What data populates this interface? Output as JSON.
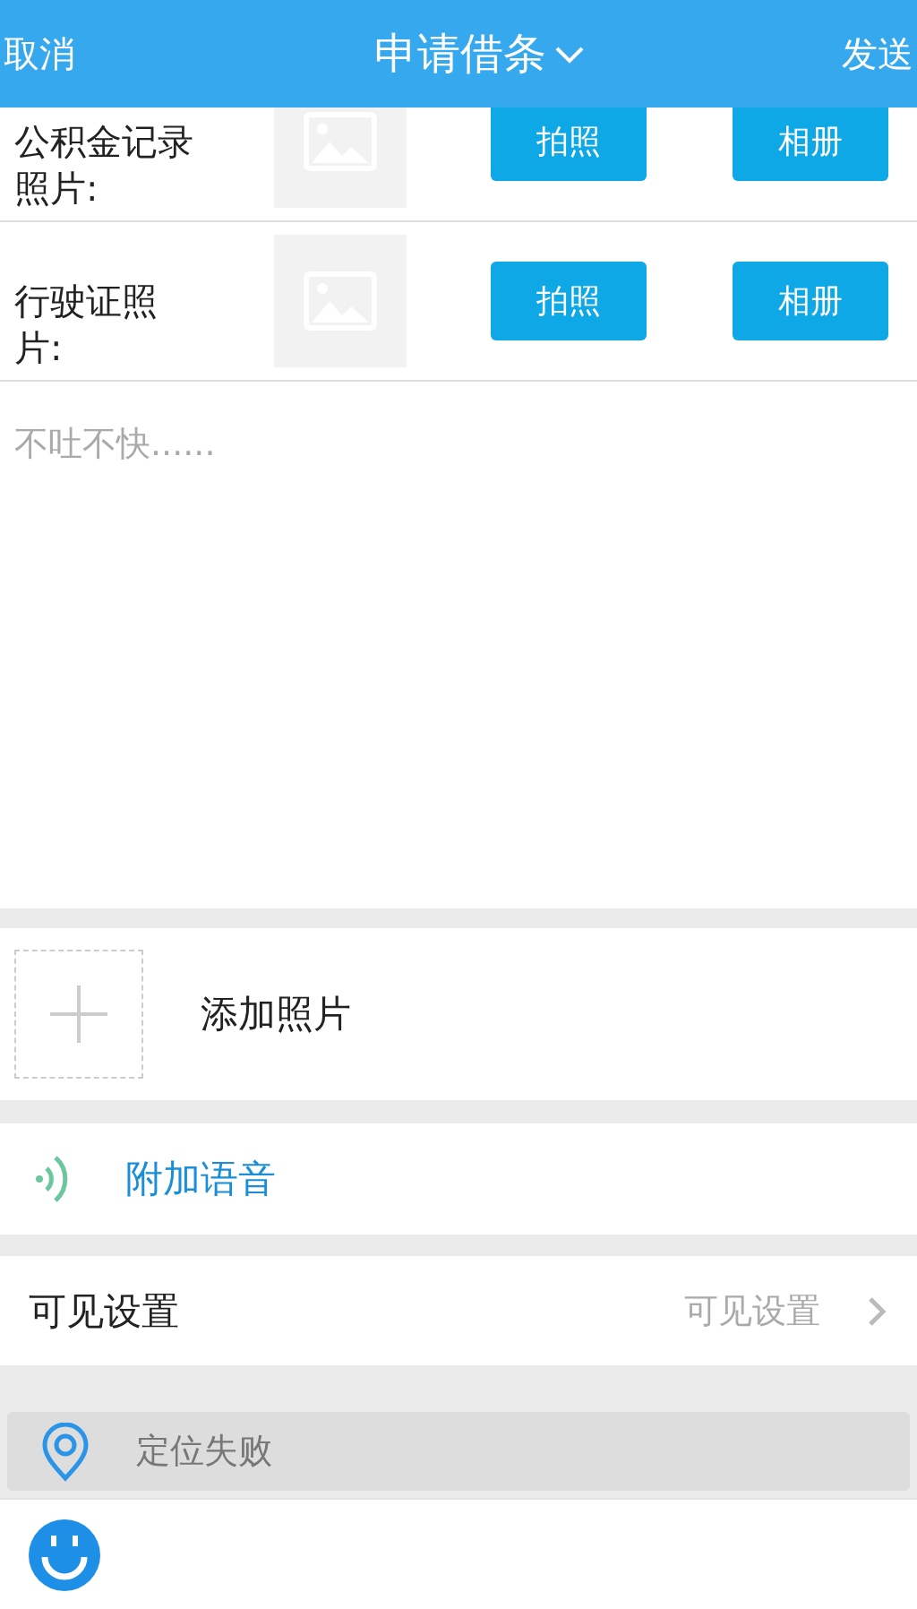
{
  "header": {
    "cancel": "取消",
    "title": "申请借条",
    "send": "发送"
  },
  "photo_rows": [
    {
      "label": "公积金记录照片:",
      "take_photo": "拍照",
      "album": "相册"
    },
    {
      "label": "行驶证照片:",
      "take_photo": "拍照",
      "album": "相册"
    }
  ],
  "note": {
    "placeholder": "不吐不快......"
  },
  "add_photo": {
    "label": "添加照片"
  },
  "voice": {
    "label": "附加语音"
  },
  "visibility": {
    "label": "可见设置",
    "value": "可见设置"
  },
  "location": {
    "text": "定位失败"
  }
}
